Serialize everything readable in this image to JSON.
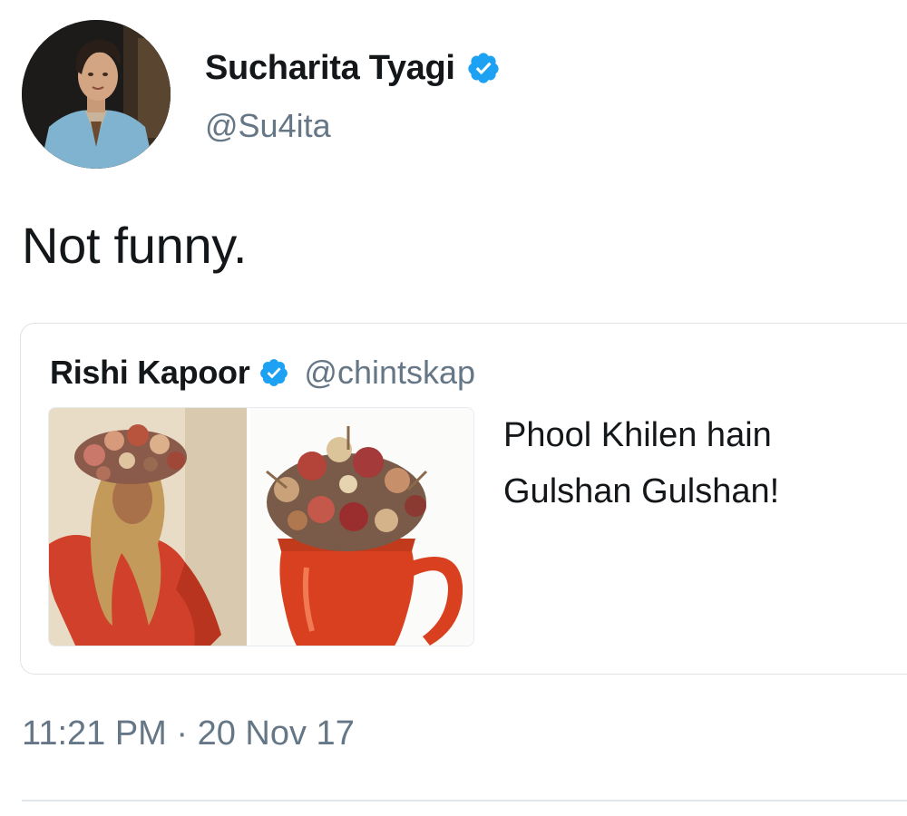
{
  "author": {
    "name": "Sucharita Tyagi",
    "handle": "@Su4ita",
    "verified": true,
    "avatar_icon": "profile-photo"
  },
  "tweet": {
    "text": "Not funny.",
    "timestamp": "11:21 PM · 20 Nov 17"
  },
  "quoted_tweet": {
    "name": "Rishi Kapoor",
    "handle": "@chintskap",
    "verified": true,
    "text": "Phool Khilen hain Gulshan Gulshan!",
    "media_icon": "side-by-side-photo-woman-flower-crown-and-flower-vase"
  },
  "colors": {
    "verified_blue": "#1da1f2",
    "secondary_text": "#657786",
    "primary_text": "#14171a"
  }
}
